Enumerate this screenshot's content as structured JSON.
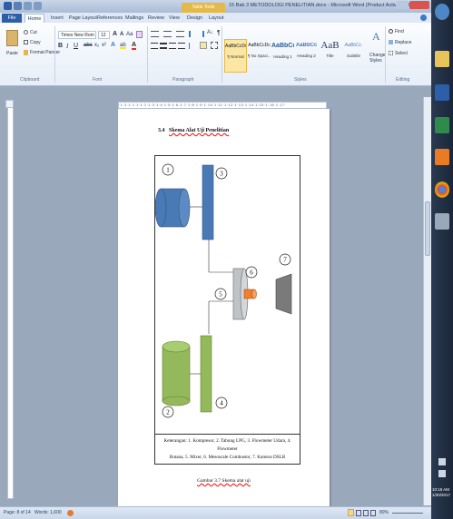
{
  "window": {
    "context_tab": "Table Tools",
    "title": "15 Bab 3 METODOLOGI PENELITIAN.docx - Microsoft Word (Product Activation Failed)"
  },
  "tabs": [
    "File",
    "Home",
    "Insert",
    "Page Layout",
    "References",
    "Mailings",
    "Review",
    "View",
    "Design",
    "Layout"
  ],
  "clipboard": {
    "paste": "Paste",
    "cut": "Cut",
    "copy": "Copy",
    "format_painter": "Format Painter",
    "label": "Clipboard"
  },
  "font": {
    "name": "Times New Rom",
    "size": "12",
    "label": "Font"
  },
  "paragraph": {
    "label": "Paragraph"
  },
  "styles": {
    "items": [
      {
        "sample": "AaBbCcDc",
        "name": "¶ Normal"
      },
      {
        "sample": "AaBbCcDc",
        "name": "¶ No Spaci..."
      },
      {
        "sample": "AaBbCc",
        "name": "Heading 1"
      },
      {
        "sample": "AaBbCc",
        "name": "Heading 2"
      },
      {
        "sample": "AaB",
        "name": "Title"
      },
      {
        "sample": "AaBbCc.",
        "name": "Subtitle"
      }
    ],
    "change_styles": "Change Styles",
    "label": "Styles"
  },
  "editing": {
    "find": "Find",
    "replace": "Replace",
    "select": "Select",
    "label": "Editing"
  },
  "document": {
    "heading_number": "3.4",
    "heading_text": "Skema Alat Uji Penelitian",
    "caption_line1": "Keterangan: 1. Kompresor, 2. Tabung LPG, 3. Flowmeter Udara, 4. Flowmeter",
    "caption_line2": "Butana, 5. Mixer, 6. Mesoscale Combustor, 7. Kamera DSLR",
    "figure_caption": "Gambar 3.7 Skema alat uji",
    "labels": [
      "1",
      "2",
      "3",
      "4",
      "5",
      "6",
      "7"
    ]
  },
  "status": {
    "page": "Page: 8 of 14",
    "words": "Words: 1,600",
    "zoom": "80%"
  },
  "clock": {
    "time": "10:18 AM",
    "date": "1/30/2017"
  },
  "colors": {
    "blue": "#4a7ab5",
    "green": "#93b95a",
    "orange": "#f07f2c",
    "gray": "#bfc3c8",
    "dark_gray": "#7a7a7a"
  }
}
